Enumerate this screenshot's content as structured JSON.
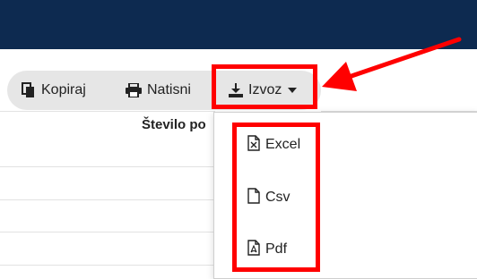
{
  "toolbar": {
    "copy_label": "Kopiraj",
    "print_label": "Natisni",
    "export_label": "Izvoz"
  },
  "table": {
    "column_header": "Število po"
  },
  "export_menu": {
    "items": [
      {
        "label": "Excel",
        "icon": "file-excel-icon"
      },
      {
        "label": "Csv",
        "icon": "file-icon"
      },
      {
        "label": "Pdf",
        "icon": "file-pdf-icon"
      }
    ]
  },
  "colors": {
    "header_bg": "#0d2a50",
    "toolbar_bg": "#e6e6e6",
    "highlight": "#ff0000"
  }
}
